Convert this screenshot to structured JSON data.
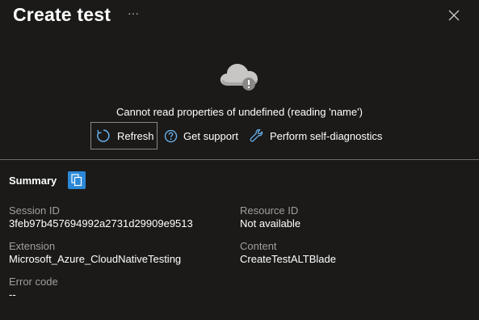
{
  "header": {
    "title": "Create test",
    "more_label": "···"
  },
  "error": {
    "icon": "cloud-error-icon",
    "message": "Cannot read properties of undefined (reading 'name')"
  },
  "actions": {
    "refresh": {
      "label": "Refresh",
      "icon": "refresh-icon"
    },
    "support": {
      "label": "Get support",
      "icon": "help-circle-icon"
    },
    "diagnostics": {
      "label": "Perform self-diagnostics",
      "icon": "wrench-icon"
    }
  },
  "summary": {
    "title": "Summary",
    "copy_icon": "copy-icon",
    "fields": {
      "session_id": {
        "label": "Session ID",
        "value": "3feb97b457694992a2731d29909e9513"
      },
      "resource_id": {
        "label": "Resource ID",
        "value": "Not available"
      },
      "extension": {
        "label": "Extension",
        "value": "Microsoft_Azure_CloudNativeTesting"
      },
      "content": {
        "label": "Content",
        "value": "CreateTestALTBlade"
      },
      "error_code": {
        "label": "Error code",
        "value": "--"
      }
    }
  },
  "colors": {
    "background": "#1b1a19",
    "accent": "#2b88d8",
    "icon_blue": "#6cb8f6",
    "muted_text": "#a19f9d"
  }
}
